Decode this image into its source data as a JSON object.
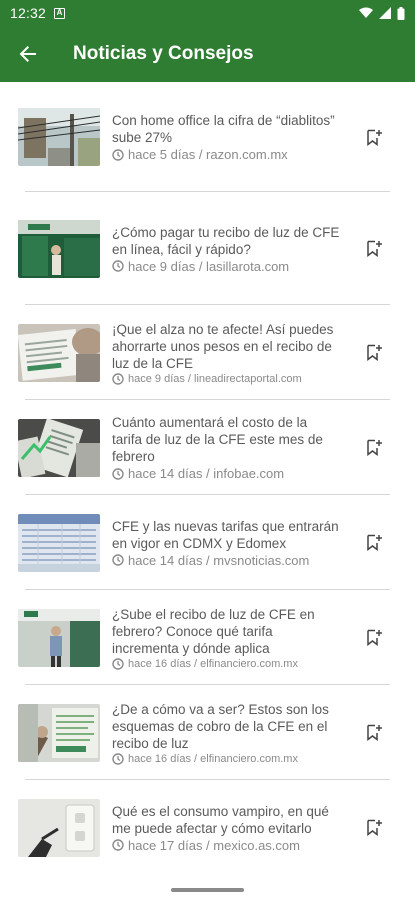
{
  "status_bar": {
    "time": "12:32"
  },
  "app_bar": {
    "title": "Noticias y Consejos"
  },
  "colors": {
    "primary": "#2f7d32",
    "text": "#5a5a5a",
    "meta": "#8a8a8a"
  },
  "icons": {
    "back": "arrow-back-icon",
    "clock": "clock-icon",
    "bookmark": "bookmark-add-icon"
  },
  "news": [
    {
      "headline": "Con home office la cifra de “diablitos” sube 27%",
      "meta": "hace 5 días / razon.com.mx"
    },
    {
      "headline": "¿Cómo pagar tu recibo de luz de CFE en línea, fácil y rápido?",
      "meta": "hace 9 días / lasillarota.com"
    },
    {
      "headline": "¡Que el alza no te afecte! Así puedes ahorrarte unos pesos en el recibo de luz de la CFE",
      "meta": "hace 9 días / lineadirectaportal.com"
    },
    {
      "headline": "Cuánto aumentará el costo de la tarifa de luz de la CFE este mes de febrero",
      "meta": "hace 14 días / infobae.com"
    },
    {
      "headline": "CFE y las nuevas tarifas que entrarán en vigor en CDMX y Edomex",
      "meta": "hace 14 días / mvsnoticias.com"
    },
    {
      "headline": "¿Sube el recibo de luz de CFE en febrero? Conoce qué tarifa incrementa y dónde aplica",
      "meta": "hace 16 días / elfinanciero.com.mx"
    },
    {
      "headline": "¿De a cómo va a ser? Estos son los esquemas de cobro de la CFE en el recibo de luz",
      "meta": "hace 16 días / elfinanciero.com.mx"
    },
    {
      "headline": "Qué es el consumo vampiro, en qué me puede afectar y cómo evitarlo",
      "meta": "hace 17 días / mexico.as.com"
    }
  ]
}
